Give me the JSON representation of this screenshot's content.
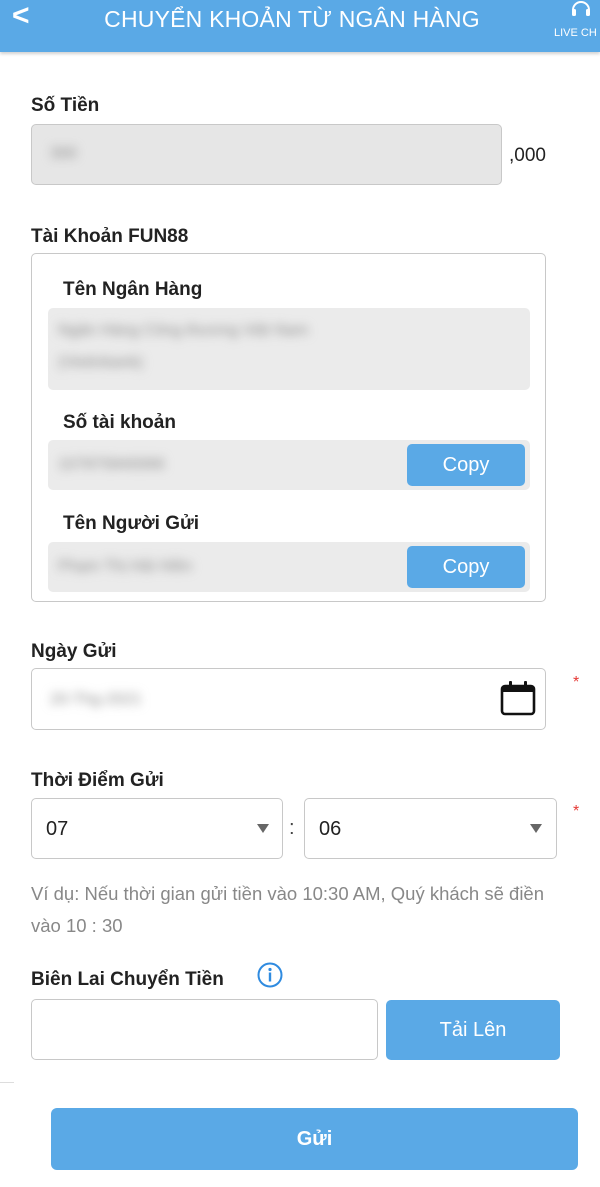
{
  "header": {
    "back_symbol": "<",
    "title": "CHUYỂN KHOẢN TỪ NGÂN HÀNG",
    "live_chat_label": "LIVE CH",
    "color": "#5aa9e6"
  },
  "amount": {
    "label": "Số Tiền",
    "value": "300",
    "suffix": ",000"
  },
  "account_card": {
    "title": "Tài Khoản FUN88",
    "bank_label": "Tên Ngân Hàng",
    "bank_value_line1": "Ngân Hàng Công thương Việt Nam",
    "bank_value_line2": "(Vietinbank)",
    "account_number_label": "Số tài khoản",
    "account_number_value": "107875840066",
    "sender_label": "Tên Người Gửi",
    "sender_value": "Phạm Thị Hải Hiền",
    "copy_label": "Copy"
  },
  "date": {
    "label": "Ngày Gửi",
    "value": "20-Thg-2021",
    "icon": "calendar-icon",
    "required_mark": "*"
  },
  "time": {
    "label": "Thời Điểm Gửi",
    "hour": "07",
    "separator": ":",
    "minute": "06",
    "required_mark": "*",
    "hint": "Ví dụ: Nếu thời gian gửi tiền vào 10:30 AM, Quý khách sẽ điền vào 10 : 30"
  },
  "receipt": {
    "label": "Biên Lai Chuyển Tiền",
    "info_icon": "info-icon",
    "upload_label": "Tải Lên"
  },
  "submit": {
    "label": "Gửi"
  }
}
